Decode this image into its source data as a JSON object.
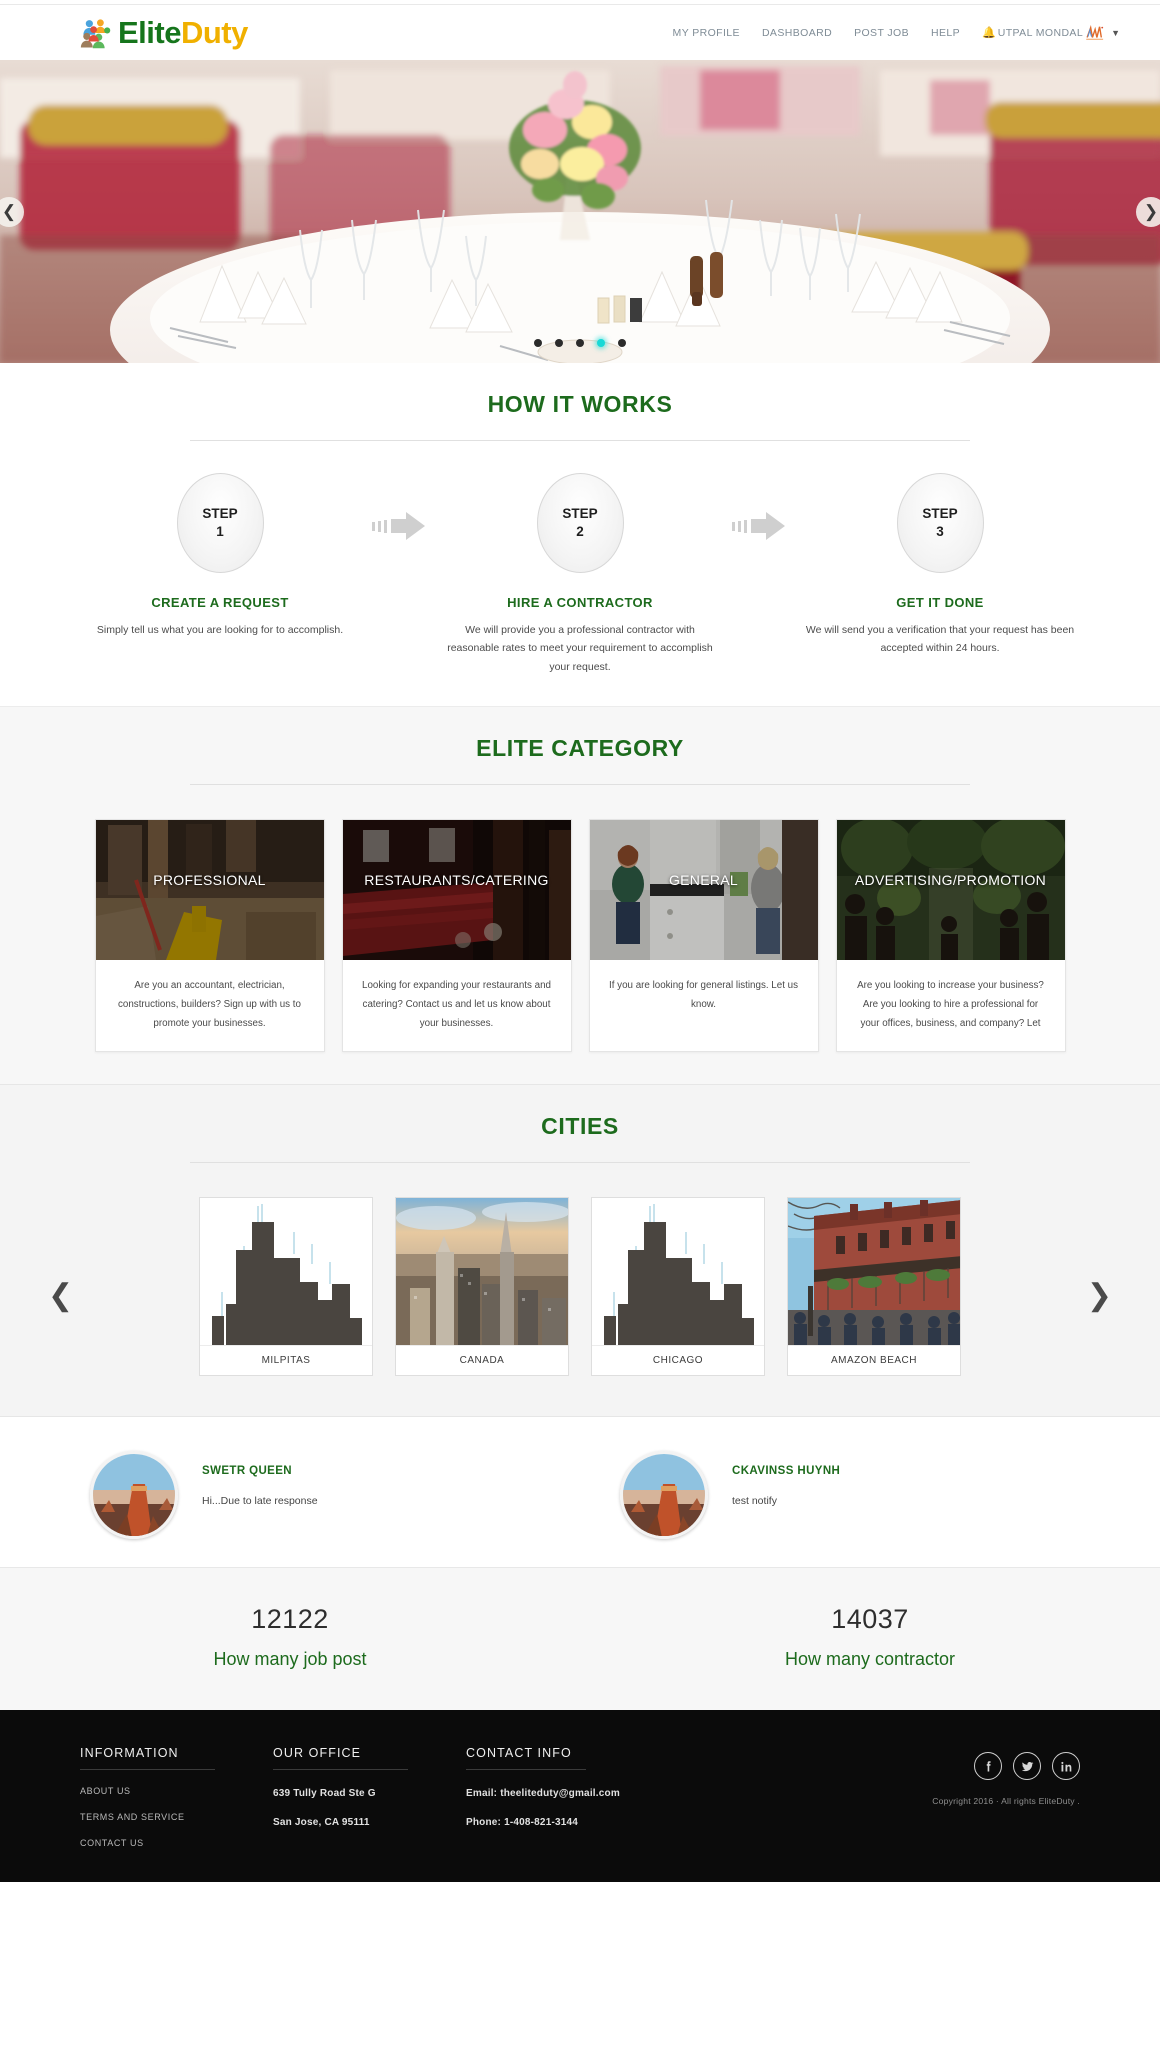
{
  "header": {
    "logo": {
      "part1": "Elite",
      "part2": "Duty",
      "icon": "people-circle-logo-icon"
    },
    "nav": [
      {
        "label": "MY PROFILE",
        "name": "nav-my-profile"
      },
      {
        "label": "DASHBOARD",
        "name": "nav-dashboard"
      },
      {
        "label": "POST JOB",
        "name": "nav-post-job"
      },
      {
        "label": "HELP",
        "name": "nav-help"
      }
    ],
    "user": {
      "name": "UTPAL MONDAL",
      "bell_icon": "bell-icon",
      "avatar_icon": "wave-avatar-icon",
      "caret_icon": "chevron-down-icon"
    }
  },
  "hero": {
    "prev_icon": "chevron-left-icon",
    "next_icon": "chevron-right-icon",
    "dots": 5,
    "active_dot": 3,
    "active_color": "#17d9d6",
    "alt": "banquet-table-with-flowers-and-glassware"
  },
  "how_it_works": {
    "title": "HOW IT WORKS",
    "steps": [
      {
        "circle_line1": "STEP",
        "circle_line2": "1",
        "head": "CREATE A REQUEST",
        "desc": "Simply tell us what you are looking for to accomplish."
      },
      {
        "circle_line1": "STEP",
        "circle_line2": "2",
        "head": "HIRE A CONTRACTOR",
        "desc": "We will provide you a professional contractor with reasonable\nrates to meet your requirement to accomplish your request."
      },
      {
        "circle_line1": "STEP",
        "circle_line2": "3",
        "head": "GET IT DONE",
        "desc": "We will send you a verification that your request has been accepted within 24 hours."
      }
    ]
  },
  "elite_category": {
    "title": "ELITE CATEGORY",
    "cards": [
      {
        "label": "PROFESSIONAL",
        "desc": "Are you an accountant, electrician, constructions, builders? Sign up with us to promote your businesses.",
        "image": "workshop-tools-photo"
      },
      {
        "label": "RESTAURANTS/CATERING",
        "desc": "Looking for expanding your restaurants and catering? Contact us and let us know about your businesses.",
        "image": "restaurant-interior-photo"
      },
      {
        "label": "GENERAL",
        "desc": "If you are looking for general listings. Let us know.",
        "image": "kitchen-people-photo"
      },
      {
        "label": "ADVERTISING/PROMOTION",
        "desc": "Are you looking to increase your business? Are you looking to hire a professional for your offices, business, and company? Let",
        "image": "garden-crowd-photo"
      }
    ]
  },
  "cities": {
    "title": "CITIES",
    "prev_icon": "chevron-left-icon",
    "next_icon": "chevron-right-icon",
    "items": [
      {
        "name": "MILPITAS",
        "image": "city-skyline-silhouette"
      },
      {
        "name": "CANADA",
        "image": "aerial-city-photo"
      },
      {
        "name": "CHICAGO",
        "image": "city-skyline-silhouette"
      },
      {
        "name": "AMAZON BEACH",
        "image": "french-quarter-building-photo"
      }
    ]
  },
  "notifications": [
    {
      "name": "SWETR QUEEN",
      "message": "Hi...Due to late response",
      "avatar": "desert-butte-photo"
    },
    {
      "name": "CKAVINSS HUYNH",
      "message": "test notify",
      "avatar": "desert-butte-photo"
    }
  ],
  "stats": [
    {
      "value": "12122",
      "label": "How many job post"
    },
    {
      "value": "14037",
      "label": "How many contractor"
    }
  ],
  "footer": {
    "information": {
      "title": "INFORMATION",
      "links": [
        "ABOUT US",
        "TERMS AND SERVICE",
        "CONTACT US"
      ]
    },
    "office": {
      "title": "OUR OFFICE",
      "lines": [
        "639 Tully Road Ste G",
        "San Jose, CA 95111"
      ]
    },
    "contact": {
      "title": "CONTACT INFO",
      "email": "Email: theeliteduty@gmail.com",
      "phone": "Phone: 1-408-821-3144"
    },
    "social": [
      {
        "name": "facebook-icon",
        "glyph": "f"
      },
      {
        "name": "twitter-icon",
        "glyph": "t"
      },
      {
        "name": "linkedin-icon",
        "glyph": "in"
      }
    ],
    "copyright": "Copyright 2016 · All rights EliteDuty ."
  }
}
